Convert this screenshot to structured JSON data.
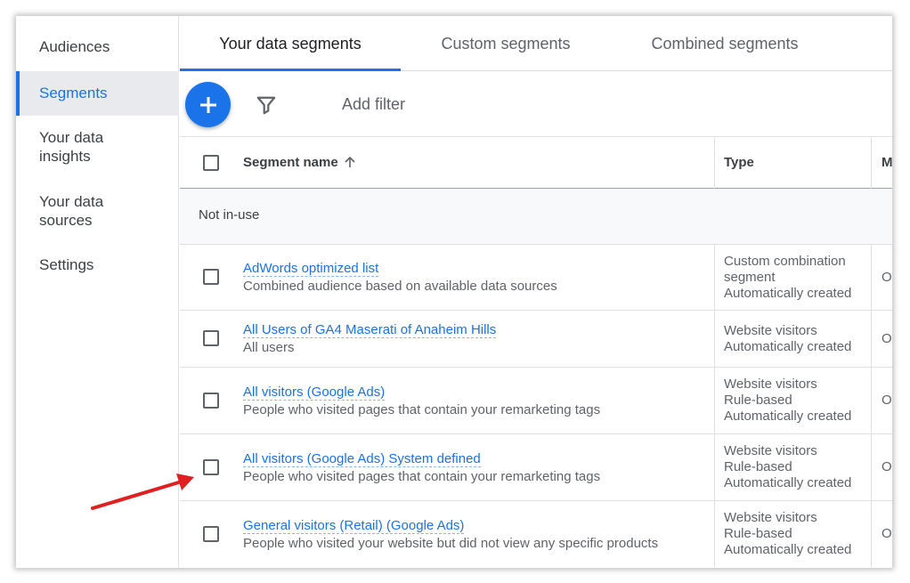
{
  "sidebar": {
    "items": [
      {
        "label": "Audiences"
      },
      {
        "label": "Segments"
      },
      {
        "label": "Your data insights"
      },
      {
        "label": "Your data sources"
      },
      {
        "label": "Settings"
      }
    ]
  },
  "tabs": [
    {
      "label": "Your data segments"
    },
    {
      "label": "Custom segments"
    },
    {
      "label": "Combined segments"
    }
  ],
  "toolbar": {
    "add_icon": "plus-icon",
    "filter_icon": "filter-icon",
    "add_filter_label": "Add filter"
  },
  "table": {
    "columns": {
      "name": "Segment name",
      "type": "Type",
      "membership": "M"
    },
    "group_label": "Not in-use",
    "rows": [
      {
        "name": "AdWords optimized list",
        "description": "Combined audience based on available data sources",
        "type_lines": [
          "Custom combination",
          "segment",
          "Automatically created"
        ],
        "m": "O"
      },
      {
        "name": "All Users of GA4 Maserati of Anaheim Hills",
        "description": "All users",
        "type_lines": [
          "Website visitors",
          "Automatically created"
        ],
        "m": "O"
      },
      {
        "name": "All visitors (Google Ads)",
        "description": "People who visited pages that contain your remarketing tags",
        "type_lines": [
          "Website visitors",
          "Rule-based",
          "Automatically created"
        ],
        "m": "O"
      },
      {
        "name": "All visitors (Google Ads) System defined",
        "description": "People who visited pages that contain your remarketing tags",
        "type_lines": [
          "Website visitors",
          "Rule-based",
          "Automatically created"
        ],
        "m": "O"
      },
      {
        "name": "General visitors (Retail) (Google Ads)",
        "description": "People who visited your website but did not view any specific products",
        "type_lines": [
          "Website visitors",
          "Rule-based",
          "Automatically created"
        ],
        "m": "O"
      }
    ]
  },
  "colors": {
    "accent": "#1a73e8",
    "arrow": "#e02020"
  }
}
